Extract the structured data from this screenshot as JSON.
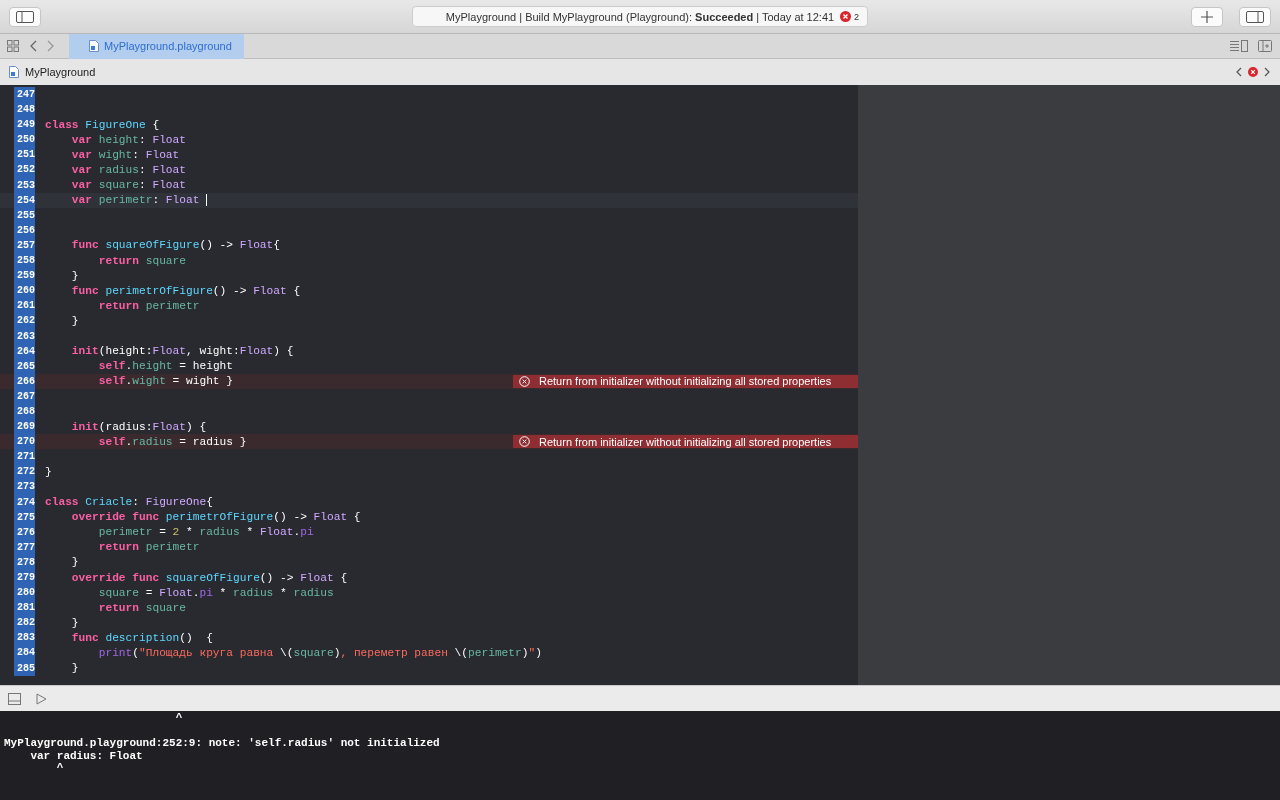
{
  "toolbar": {
    "status": "MyPlayground | Build MyPlayground (Playground): **Succeeded** | Today at 12:41",
    "error_count": "2"
  },
  "tabs": [
    {
      "label": "MyPlayground.playground",
      "selected": true
    }
  ],
  "breadcrumb": {
    "label": "MyPlayground"
  },
  "editor": {
    "lines": [
      {
        "number": "247",
        "current": false,
        "error": false
      },
      {
        "number": "248",
        "current": false,
        "error": false
      },
      {
        "number": "249",
        "current": false,
        "error": false,
        "tokens": [
          {
            "text": "class",
            "kind": "kw"
          },
          {
            "text": " FigureOne",
            "kind": "decl"
          },
          {
            "text": " {",
            "kind": "plain"
          }
        ]
      },
      {
        "number": "250",
        "current": false,
        "error": false,
        "tokens": [
          {
            "text": "    var",
            "kind": "kw"
          },
          {
            "text": " height",
            "kind": "prop"
          },
          {
            "text": ":",
            "kind": "plain"
          },
          {
            "text": " Float",
            "kind": "type"
          }
        ]
      },
      {
        "number": "251",
        "current": false,
        "error": false,
        "tokens": [
          {
            "text": "    var",
            "kind": "kw"
          },
          {
            "text": " wight",
            "kind": "prop"
          },
          {
            "text": ":",
            "kind": "plain"
          },
          {
            "text": " Float",
            "kind": "type"
          }
        ]
      },
      {
        "number": "252",
        "current": false,
        "error": false,
        "tokens": [
          {
            "text": "    var",
            "kind": "kw"
          },
          {
            "text": " radius",
            "kind": "prop"
          },
          {
            "text": ":",
            "kind": "plain"
          },
          {
            "text": " Float",
            "kind": "type"
          }
        ]
      },
      {
        "number": "253",
        "current": false,
        "error": false,
        "tokens": [
          {
            "text": "    var",
            "kind": "kw"
          },
          {
            "text": " square",
            "kind": "prop"
          },
          {
            "text": ":",
            "kind": "plain"
          },
          {
            "text": " Float",
            "kind": "type"
          }
        ]
      },
      {
        "number": "254",
        "current": true,
        "error": false,
        "tokens": [
          {
            "text": "    var",
            "kind": "kw"
          },
          {
            "text": " perimetr",
            "kind": "prop"
          },
          {
            "text": ":",
            "kind": "plain"
          },
          {
            "text": " Float",
            "kind": "type"
          }
        ]
      },
      {
        "number": "255",
        "current": false,
        "error": false
      },
      {
        "number": "256",
        "current": false,
        "error": false
      },
      {
        "number": "257",
        "current": false,
        "error": false,
        "tokens": [
          {
            "text": "    func",
            "kind": "kw"
          },
          {
            "text": " squareOfFigure",
            "kind": "decl"
          },
          {
            "text": "() ->",
            "kind": "plain"
          },
          {
            "text": " Float",
            "kind": "type"
          },
          {
            "text": "{",
            "kind": "plain"
          }
        ]
      },
      {
        "number": "258",
        "current": false,
        "error": false,
        "tokens": [
          {
            "text": "        return",
            "kind": "kw"
          },
          {
            "text": " square",
            "kind": "prop"
          }
        ]
      },
      {
        "number": "259",
        "current": false,
        "error": false,
        "tokens": [
          {
            "text": "    }",
            "kind": "plain"
          }
        ]
      },
      {
        "number": "260",
        "current": false,
        "error": false,
        "tokens": [
          {
            "text": "    func",
            "kind": "kw"
          },
          {
            "text": " perimetrOfFigure",
            "kind": "decl"
          },
          {
            "text": "() ->",
            "kind": "plain"
          },
          {
            "text": " Float",
            "kind": "type"
          },
          {
            "text": " {",
            "kind": "plain"
          }
        ]
      },
      {
        "number": "261",
        "current": false,
        "error": false,
        "tokens": [
          {
            "text": "        return",
            "kind": "kw"
          },
          {
            "text": " perimetr",
            "kind": "prop"
          }
        ]
      },
      {
        "number": "262",
        "current": false,
        "error": false,
        "tokens": [
          {
            "text": "    }",
            "kind": "plain"
          }
        ]
      },
      {
        "number": "263",
        "current": false,
        "error": false
      },
      {
        "number": "264",
        "current": false,
        "error": false,
        "tokens": [
          {
            "text": "    init",
            "kind": "kw"
          },
          {
            "text": "(height:",
            "kind": "plain"
          },
          {
            "text": "Float",
            "kind": "type"
          },
          {
            "text": ", wight:",
            "kind": "plain"
          },
          {
            "text": "Float",
            "kind": "type"
          },
          {
            "text": ") {",
            "kind": "plain"
          }
        ]
      },
      {
        "number": "265",
        "current": false,
        "error": false,
        "tokens": [
          {
            "text": "        self",
            "kind": "kw"
          },
          {
            "text": ".",
            "kind": "plain"
          },
          {
            "text": "height",
            "kind": "prop"
          },
          {
            "text": " = height",
            "kind": "plain"
          }
        ]
      },
      {
        "number": "266",
        "current": false,
        "error": true,
        "error_message": "Return from initializer without initializing all stored properties",
        "tokens": [
          {
            "text": "        self",
            "kind": "kw"
          },
          {
            "text": ".",
            "kind": "plain"
          },
          {
            "text": "wight",
            "kind": "prop"
          },
          {
            "text": " = wight }",
            "kind": "plain"
          }
        ]
      },
      {
        "number": "267",
        "current": false,
        "error": false
      },
      {
        "number": "268",
        "current": false,
        "error": false
      },
      {
        "number": "269",
        "current": false,
        "error": false,
        "tokens": [
          {
            "text": "    init",
            "kind": "kw"
          },
          {
            "text": "(radius:",
            "kind": "plain"
          },
          {
            "text": "Float",
            "kind": "type"
          },
          {
            "text": ") {",
            "kind": "plain"
          }
        ]
      },
      {
        "number": "270",
        "current": false,
        "error": true,
        "error_message": "Return from initializer without initializing all stored properties",
        "tokens": [
          {
            "text": "        self",
            "kind": "kw"
          },
          {
            "text": ".",
            "kind": "plain"
          },
          {
            "text": "radius",
            "kind": "prop"
          },
          {
            "text": " = radius }",
            "kind": "plain"
          }
        ]
      },
      {
        "number": "271",
        "current": false,
        "error": false
      },
      {
        "number": "272",
        "current": false,
        "error": false,
        "tokens": [
          {
            "text": "}",
            "kind": "plain"
          }
        ]
      },
      {
        "number": "273",
        "current": false,
        "error": false
      },
      {
        "number": "274",
        "current": false,
        "error": false,
        "tokens": [
          {
            "text": "class",
            "kind": "kw"
          },
          {
            "text": " Criacle",
            "kind": "decl"
          },
          {
            "text": ":",
            "kind": "plain"
          },
          {
            "text": " FigureOne",
            "kind": "type"
          },
          {
            "text": "{",
            "kind": "plain"
          }
        ]
      },
      {
        "number": "275",
        "current": false,
        "error": false,
        "tokens": [
          {
            "text": "    override func",
            "kind": "kw"
          },
          {
            "text": " perimetrOfFigure",
            "kind": "decl"
          },
          {
            "text": "() ->",
            "kind": "plain"
          },
          {
            "text": " Float",
            "kind": "type"
          },
          {
            "text": " {",
            "kind": "plain"
          }
        ]
      },
      {
        "number": "276",
        "current": false,
        "error": false,
        "tokens": [
          {
            "text": "        perimetr",
            "kind": "prop"
          },
          {
            "text": " =",
            "kind": "plain"
          },
          {
            "text": " 2",
            "kind": "num"
          },
          {
            "text": " *",
            "kind": "plain"
          },
          {
            "text": " radius",
            "kind": "prop"
          },
          {
            "text": " *",
            "kind": "plain"
          },
          {
            "text": " Float",
            "kind": "type"
          },
          {
            "text": ".",
            "kind": "plain"
          },
          {
            "text": "pi",
            "kind": "member"
          }
        ]
      },
      {
        "number": "277",
        "current": false,
        "error": false,
        "tokens": [
          {
            "text": "        return",
            "kind": "kw"
          },
          {
            "text": " perimetr",
            "kind": "prop"
          }
        ]
      },
      {
        "number": "278",
        "current": false,
        "error": false,
        "tokens": [
          {
            "text": "    }",
            "kind": "plain"
          }
        ]
      },
      {
        "number": "279",
        "current": false,
        "error": false,
        "tokens": [
          {
            "text": "    override func",
            "kind": "kw"
          },
          {
            "text": " squareOfFigure",
            "kind": "decl"
          },
          {
            "text": "() ->",
            "kind": "plain"
          },
          {
            "text": " Float",
            "kind": "type"
          },
          {
            "text": " {",
            "kind": "plain"
          }
        ]
      },
      {
        "number": "280",
        "current": false,
        "error": false,
        "tokens": [
          {
            "text": "        square",
            "kind": "prop"
          },
          {
            "text": " =",
            "kind": "plain"
          },
          {
            "text": " Float",
            "kind": "type"
          },
          {
            "text": ".",
            "kind": "plain"
          },
          {
            "text": "pi",
            "kind": "member"
          },
          {
            "text": " *",
            "kind": "plain"
          },
          {
            "text": " radius",
            "kind": "prop"
          },
          {
            "text": " *",
            "kind": "plain"
          },
          {
            "text": " radius",
            "kind": "prop"
          }
        ]
      },
      {
        "number": "281",
        "current": false,
        "error": false,
        "tokens": [
          {
            "text": "        return",
            "kind": "kw"
          },
          {
            "text": " square",
            "kind": "prop"
          }
        ]
      },
      {
        "number": "282",
        "current": false,
        "error": false,
        "tokens": [
          {
            "text": "    }",
            "kind": "plain"
          }
        ]
      },
      {
        "number": "283",
        "current": false,
        "error": false,
        "tokens": [
          {
            "text": "    func",
            "kind": "kw"
          },
          {
            "text": " description",
            "kind": "decl"
          },
          {
            "text": "()  {",
            "kind": "plain"
          }
        ]
      },
      {
        "number": "284",
        "current": false,
        "error": false,
        "tokens": [
          {
            "text": "        print",
            "kind": "member"
          },
          {
            "text": "(",
            "kind": "plain"
          },
          {
            "text": "\"Площадь круга равна",
            "kind": "str"
          },
          {
            "text": " \\(",
            "kind": "plain"
          },
          {
            "text": "square",
            "kind": "prop"
          },
          {
            "text": ")",
            "kind": "plain"
          },
          {
            "text": ", переметр равен",
            "kind": "str"
          },
          {
            "text": " \\(",
            "kind": "plain"
          },
          {
            "text": "perimetr",
            "kind": "prop"
          },
          {
            "text": ")",
            "kind": "plain"
          },
          {
            "text": "\"",
            "kind": "str"
          },
          {
            "text": ")",
            "kind": "plain"
          }
        ]
      },
      {
        "number": "285",
        "current": false,
        "error": false,
        "tokens": [
          {
            "text": "    }",
            "kind": "plain"
          }
        ]
      }
    ]
  },
  "console": {
    "output": "                          ^\n\nMyPlayground.playground:252:9: note: 'self.radius' not initialized\n    var radius: Float\n        ^"
  }
}
